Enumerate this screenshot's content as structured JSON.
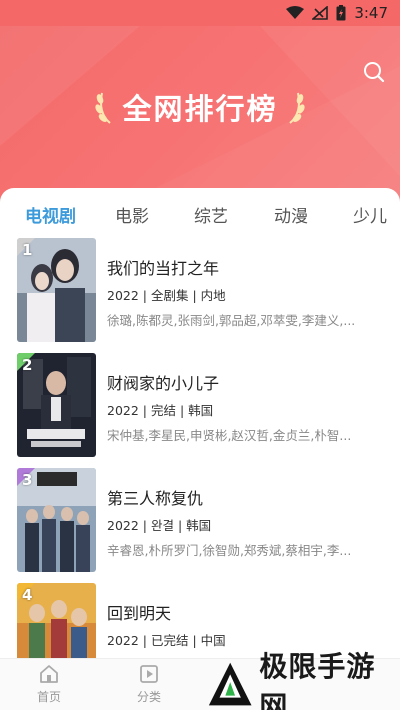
{
  "status_bar": {
    "time": "3:47"
  },
  "header": {
    "title": "全网排行榜"
  },
  "tabs": [
    {
      "label": "电视剧",
      "active": true
    },
    {
      "label": "电影",
      "active": false
    },
    {
      "label": "综艺",
      "active": false
    },
    {
      "label": "动漫",
      "active": false
    },
    {
      "label": "少儿",
      "active": false
    }
  ],
  "rankings": [
    {
      "rank": "1",
      "title": "我们的当打之年",
      "meta": "2022 | 全剧集 | 内地",
      "cast": "徐璐,陈都灵,张雨剑,郭品超,邓萃雯,李建义,...",
      "badge_color": "#cfcfcf",
      "poster_text": "我们的当打之年"
    },
    {
      "rank": "2",
      "title": "财阀家的小儿子",
      "meta": "2022 | 完结 | 韩国",
      "cast": "宋仲基,李星民,申贤彬,赵汉哲,金贞兰,朴智...",
      "badge_color": "#6fce6a",
      "poster_text": "재벌집 막내아들"
    },
    {
      "rank": "3",
      "title": "第三人称复仇",
      "meta": "2022 | 완결 | 韩国",
      "cast": "辛睿恩,朴所罗门,徐智勋,郑秀斌,蔡相宇,李...",
      "badge_color": "#b07ad9",
      "poster_text": "3인칭 복수"
    },
    {
      "rank": "4",
      "title": "回到明天",
      "meta": "2022 | 已完结 | 中国",
      "cast": "",
      "badge_color": "#f1b735",
      "poster_text": ""
    }
  ],
  "bottom_nav": [
    {
      "label": "首页",
      "icon": "home-icon"
    },
    {
      "label": "分类",
      "icon": "play-square-icon"
    }
  ],
  "watermark": {
    "text": "极限手游网"
  },
  "colors": {
    "header": "#f56868",
    "accent_tab": "#3d9bdb"
  }
}
